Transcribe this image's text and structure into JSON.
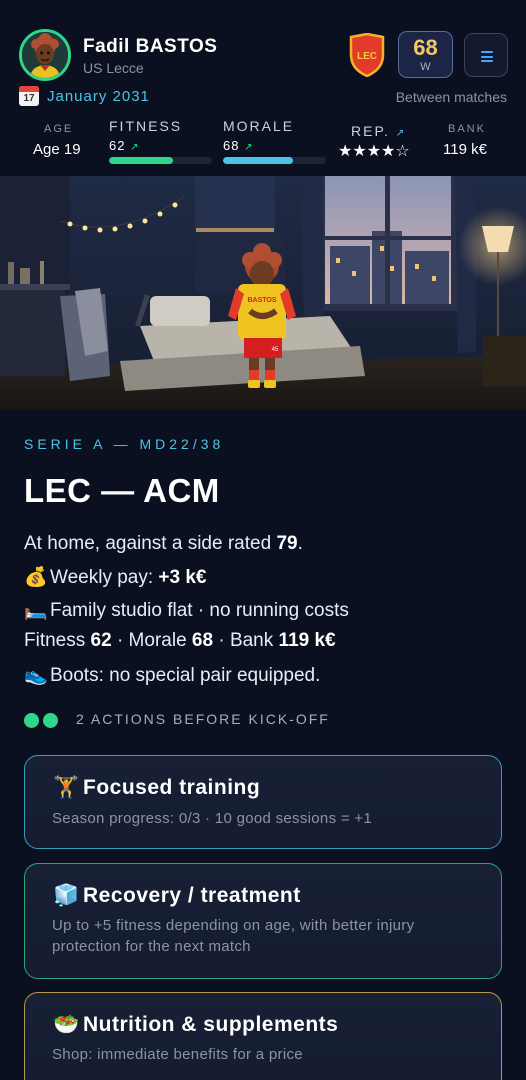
{
  "player": {
    "name": "Fadil BASTOS",
    "club": "US Lecce",
    "club_badge": "LEC",
    "rating": "68",
    "rating_sub": "W"
  },
  "date": {
    "calendar_icon": "calendar-icon",
    "calendar_day": "17",
    "text": "January 2031",
    "phase": "Between matches"
  },
  "stats": {
    "age_label": "AGE",
    "age_value": "Age 19",
    "fitness_label": "FITNESS",
    "fitness_value": "62",
    "fitness_trend": "↗",
    "fitness_fraction": 0.62,
    "morale_label": "MORALE",
    "morale_value": "68",
    "morale_trend": "↗",
    "morale_fraction": 0.68,
    "rep_label": "REP.",
    "rep_trend": "↗",
    "rep_stars": "★★★★☆",
    "rep_rating": 4,
    "bank_label": "BANK",
    "bank_value": "119 k€"
  },
  "scene": {
    "shirt_name": "BASTOS",
    "shirt_number": "45"
  },
  "match": {
    "competition": "SERIE A — MD22/38",
    "fixture": "LEC — ACM",
    "venue_text": "At home, against a side rated ",
    "opponent_rating": "79",
    "pay_icon": "💰",
    "pay_label": "Weekly pay: ",
    "pay_value": "+3 k€",
    "housing_icon": "🛏️",
    "housing_text": "Family studio flat · no running costs",
    "summary_fitness_label": "Fitness ",
    "summary_fitness_value": "62",
    "summary_morale_label": " · Morale ",
    "summary_morale_value": "68",
    "summary_bank_label": " · Bank ",
    "summary_bank_value": "119 k€",
    "boots_icon": "👟",
    "boots_text": "Boots: no special pair equipped."
  },
  "actions": {
    "remaining": 2,
    "label": "2 ACTIONS BEFORE KICK-OFF",
    "cards": [
      {
        "icon": "🏋️",
        "title": "Focused training",
        "desc": "Season progress: 0/3 · 10 good sessions = +1",
        "border": "#2f9fb8"
      },
      {
        "icon": "🧊",
        "title": "Recovery / treatment",
        "desc": "Up to +5 fitness depending on age, with better injury protection for the next match",
        "border": "#2aa57a"
      },
      {
        "icon": "🥗",
        "title": "Nutrition & supplements",
        "desc": "Shop: immediate benefits for a price",
        "border": "#b59a4a"
      }
    ]
  },
  "colors": {
    "accent_cyan": "#4cc3e6",
    "accent_green": "#2fd68a",
    "gold": "#f4c862",
    "background": "#0b1020"
  }
}
